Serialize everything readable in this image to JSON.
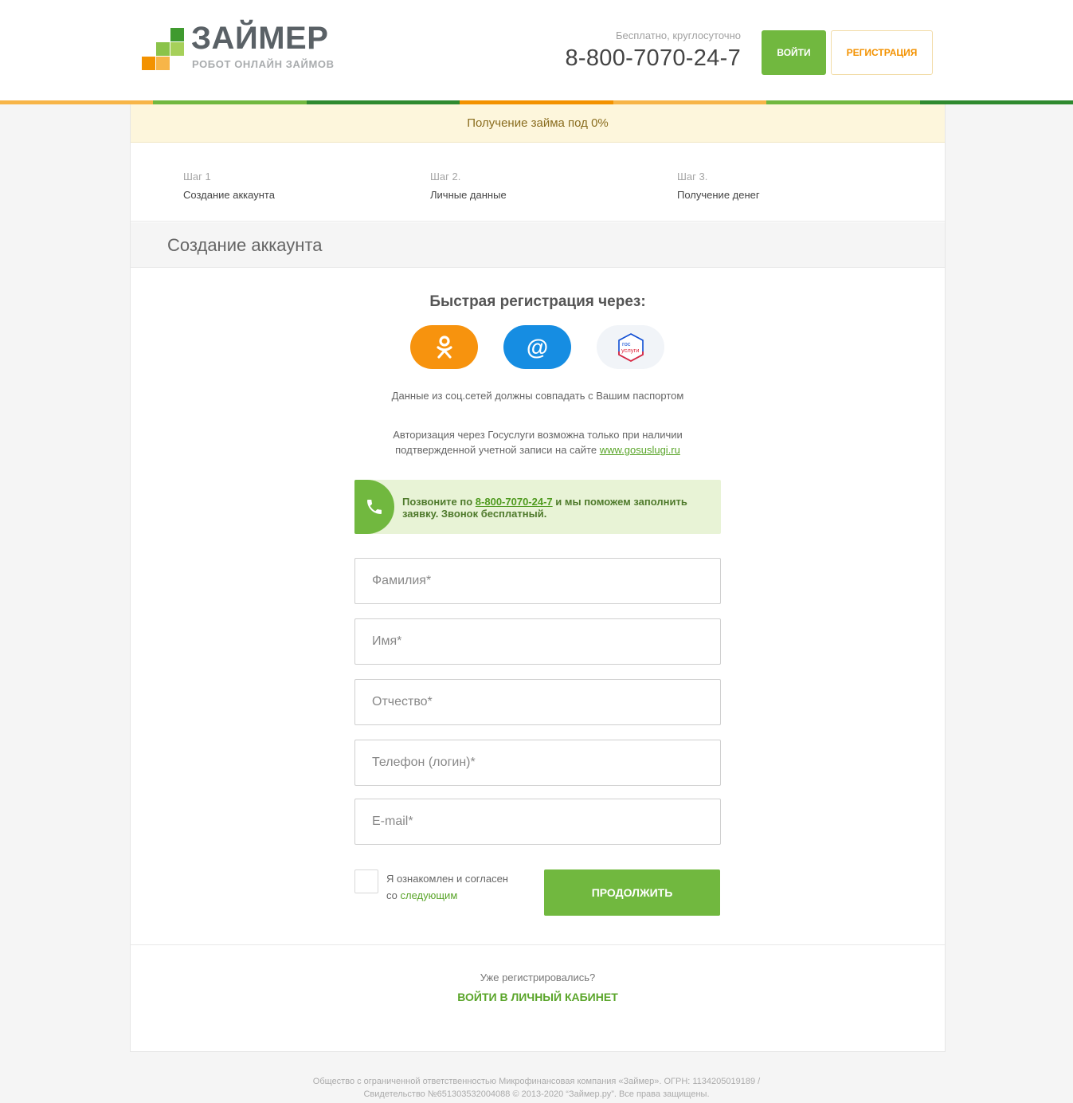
{
  "header": {
    "logo_title": "ЗАЙМЕР",
    "logo_subtitle": "РОБОТ ОНЛАЙН ЗАЙМОВ",
    "phone_hint": "Бесплатно, круглосуточно",
    "phone_number": "8-800-7070-24-7",
    "login_label": "ВОЙТИ",
    "register_label": "РЕГИСТРАЦИЯ"
  },
  "colors": {
    "green": "#71b83f",
    "dark_green": "#2f8a2f",
    "orange": "#f39200",
    "yellow": "#f7b548"
  },
  "promo": "Получение займа под 0%",
  "steps": [
    {
      "num": "Шаг 1",
      "name": "Создание аккаунта"
    },
    {
      "num": "Шаг 2.",
      "name": "Личные данные"
    },
    {
      "num": "Шаг 3.",
      "name": "Получение денег"
    }
  ],
  "section_title": "Создание аккаунта",
  "quick": {
    "title": "Быстрая регистрация через:",
    "providers": [
      {
        "name": "Одноклассники",
        "icon": "odnoklassniki-icon"
      },
      {
        "name": "Mail.ru",
        "icon": "at-icon",
        "glyph": "@"
      },
      {
        "name": "Госуслуги",
        "icon": "gosuslugi-icon",
        "logo_line1": "гос",
        "logo_line2": "услуги"
      }
    ]
  },
  "notes": {
    "social_match": "Данные из соц.сетей должны совпадать с Вашим паспортом",
    "gosuslugi_line1": "Авторизация через Госуслуги возможна только при наличии",
    "gosuslugi_line2": "подтвержденной учетной записи на сайте ",
    "gosuslugi_link": "www.gosuslugi.ru"
  },
  "callbox": {
    "before": "Позвоните по ",
    "phone": "8-800-7070-24-7",
    "after": " и мы поможем заполнить заявку. Звонок бесплатный."
  },
  "form": {
    "last_name": {
      "placeholder": "Фамилия*",
      "value": ""
    },
    "first_name": {
      "placeholder": "Имя*",
      "value": ""
    },
    "middle_name": {
      "placeholder": "Отчество*",
      "value": ""
    },
    "phone": {
      "placeholder": "Телефон (логин)*",
      "value": ""
    },
    "email": {
      "placeholder": "E-mail*",
      "value": ""
    }
  },
  "agree": {
    "text_line1": "Я ознакомлен и согласен",
    "text_line2": "со ",
    "link": "следующим",
    "checked": false
  },
  "continue_label": "ПРОДОЛЖИТЬ",
  "already": {
    "question": "Уже регистрировались?",
    "link": "ВОЙТИ В ЛИЧНЫЙ КАБИНЕТ"
  },
  "footer": {
    "line1": "Общество с ограниченной ответственностью Микрофинансовая компания «Займер». ОГРН: 1134205019189 /",
    "line2": "Свидетельство №651303532004088 © 2013-2020 “Займер.ру”. Все права защищены."
  }
}
